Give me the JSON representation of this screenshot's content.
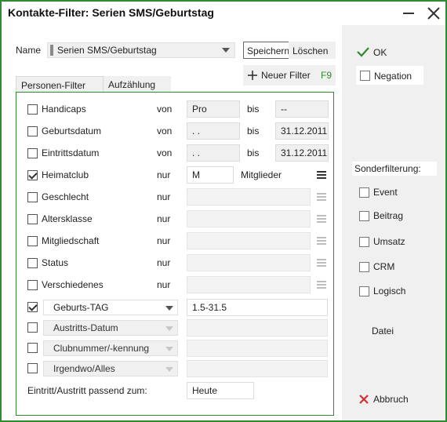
{
  "window": {
    "title": "Kontakte-Filter: Serien SMS/Geburtstag",
    "accent_color": "#2e8b2e"
  },
  "header": {
    "name_label": "Name",
    "name_value": "Serien SMS/Geburtstag",
    "speichern_label": "Speichern",
    "loeschen_label": "Löschen",
    "neuer_filter_label": "Neuer Filter",
    "neuer_filter_shortcut": "F9"
  },
  "tabs": [
    {
      "label": "Personen-Filter",
      "active": true
    },
    {
      "label": "Aufzählung",
      "active": false
    }
  ],
  "filter_rows": [
    {
      "label": "Handicaps",
      "checked": false,
      "op": "von",
      "from": "Pro",
      "to_label": "bis",
      "to": "--"
    },
    {
      "label": "Geburtsdatum",
      "checked": false,
      "op": "von",
      "from": "  .  .",
      "to_label": "bis",
      "to": "31.12.2011"
    },
    {
      "label": "Eintrittsdatum",
      "checked": false,
      "op": "von",
      "from": "  .  .",
      "to_label": "bis",
      "to": "31.12.2011"
    },
    {
      "label": "Heimatclub",
      "checked": true,
      "op": "nur",
      "value": "M",
      "suffix": "Mitglieder"
    },
    {
      "label": "Geschlecht",
      "checked": false,
      "op": "nur",
      "value": ""
    },
    {
      "label": "Altersklasse",
      "checked": false,
      "op": "nur",
      "value": ""
    },
    {
      "label": "Mitgliedschaft",
      "checked": false,
      "op": "nur",
      "value": ""
    },
    {
      "label": "Status",
      "checked": false,
      "op": "nur",
      "value": ""
    },
    {
      "label": "Verschiedenes",
      "checked": false,
      "op": "nur",
      "value": ""
    }
  ],
  "special_rows": [
    {
      "label": "Geburts-TAG",
      "checked": true,
      "value": "1.5-31.5"
    },
    {
      "label": "Austritts-Datum",
      "checked": false,
      "value": ""
    },
    {
      "label": "Clubnummer/-kennung",
      "checked": false,
      "value": ""
    },
    {
      "label": "Irgendwo/Alles",
      "checked": false,
      "value": ""
    }
  ],
  "footer": {
    "passend_label": "Eintritt/Austritt passend zum:",
    "passend_value": "Heute"
  },
  "right": {
    "ok_label": "OK",
    "negation_label": "Negation",
    "sonder_label": "Sonderfilterung:",
    "options": [
      "Event",
      "Beitrag",
      "Umsatz",
      "CRM",
      "Logisch"
    ],
    "datei_label": "Datei",
    "abbruch_label": "Abbruch"
  }
}
